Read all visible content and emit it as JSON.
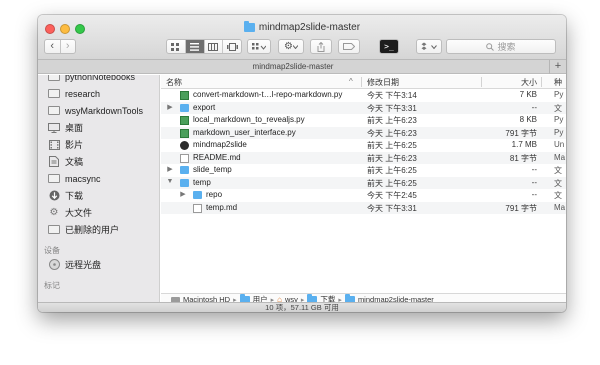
{
  "window": {
    "title": "mindmap2slide-master",
    "tab_label": "mindmap2slide-master",
    "tab_add": "+",
    "status": "10 项，57.11 GB 可用"
  },
  "toolbar": {
    "back": "‹",
    "forward": "›",
    "terminal": ">_",
    "search_placeholder": "搜索",
    "search_icon": "search-icon"
  },
  "sidebar": {
    "items": [
      {
        "label": "pythonNotebooks",
        "icon": "folder-icon"
      },
      {
        "label": "research",
        "icon": "folder-icon"
      },
      {
        "label": "wsyMarkdownTools",
        "icon": "folder-icon"
      },
      {
        "label": "桌面",
        "icon": "desktop-icon"
      },
      {
        "label": "影片",
        "icon": "movie-icon"
      },
      {
        "label": "文稿",
        "icon": "document-icon"
      },
      {
        "label": "macsync",
        "icon": "folder-icon"
      },
      {
        "label": "下载",
        "icon": "download-icon"
      },
      {
        "label": "大文件",
        "icon": "gear-icon"
      },
      {
        "label": "已删除的用户",
        "icon": "folder-icon"
      }
    ],
    "devices_header": "设备",
    "devices": [
      {
        "label": "远程光盘",
        "icon": "disc-icon"
      }
    ],
    "tags_header": "标记"
  },
  "columns": {
    "name": "名称",
    "name_sort": "^",
    "date": "修改日期",
    "size": "大小",
    "kind": "种"
  },
  "files": [
    {
      "name": "convert-markdown-t…l-repo-markdown.py",
      "date": "今天 下午3:14",
      "size": "7 KB",
      "kind": "Py",
      "type": "py",
      "depth": 0,
      "expander": ""
    },
    {
      "name": "export",
      "date": "今天 下午3:31",
      "size": "--",
      "kind": "文",
      "type": "folder",
      "depth": 0,
      "expander": "▶"
    },
    {
      "name": "local_markdown_to_revealjs.py",
      "date": "前天 上午6:23",
      "size": "8 KB",
      "kind": "Py",
      "type": "py",
      "depth": 0,
      "expander": ""
    },
    {
      "name": "markdown_user_interface.py",
      "date": "今天 上午6:23",
      "size": "791 字节",
      "kind": "Py",
      "type": "py",
      "depth": 0,
      "expander": ""
    },
    {
      "name": "mindmap2slide",
      "date": "前天 上午6:25",
      "size": "1.7 MB",
      "kind": "Un",
      "type": "exec",
      "depth": 0,
      "expander": ""
    },
    {
      "name": "README.md",
      "date": "前天 上午6:23",
      "size": "81 字节",
      "kind": "Ma",
      "type": "doc",
      "depth": 0,
      "expander": ""
    },
    {
      "name": "slide_temp",
      "date": "前天 上午6:25",
      "size": "--",
      "kind": "文",
      "type": "folder",
      "depth": 0,
      "expander": "▶"
    },
    {
      "name": "temp",
      "date": "前天 上午6:25",
      "size": "--",
      "kind": "文",
      "type": "folder",
      "depth": 0,
      "expander": "▼"
    },
    {
      "name": "repo",
      "date": "今天 下午2:45",
      "size": "--",
      "kind": "文",
      "type": "folder",
      "depth": 1,
      "expander": "▶"
    },
    {
      "name": "temp.md",
      "date": "今天 下午3:31",
      "size": "791 字节",
      "kind": "Ma",
      "type": "doc",
      "depth": 1,
      "expander": ""
    }
  ],
  "pathbar": [
    "Macintosh HD",
    "用户",
    "wsy",
    "下载",
    "mindmap2slide-master"
  ],
  "pathbar_sep": "▸"
}
